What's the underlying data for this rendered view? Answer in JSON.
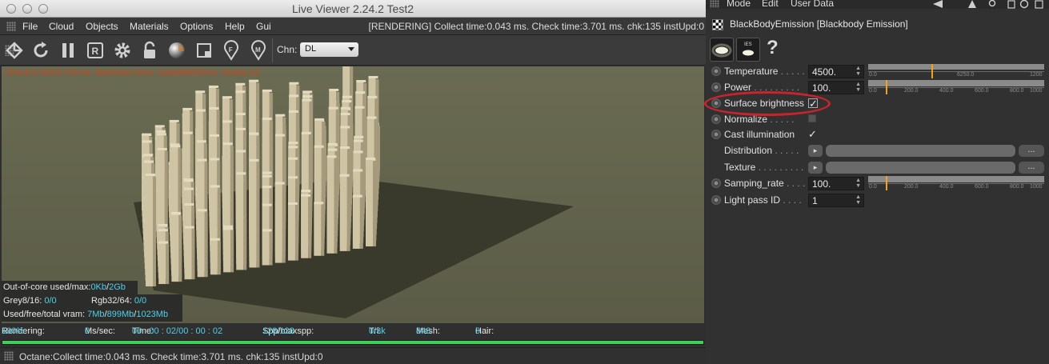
{
  "window": {
    "title": "Live Viewer 2.24.2 Test2"
  },
  "menu": {
    "items": [
      "File",
      "Cloud",
      "Objects",
      "Materials",
      "Options",
      "Help",
      "Gui"
    ],
    "render_status": "[RENDERING] Collect time:0.043 ms.  Check time:3.701 ms.  chk:135  instUpd:0"
  },
  "toolbar": {
    "icons": [
      "render-target-icon",
      "refresh-icon",
      "pause-icon",
      "region-render-icon",
      "settings-gear-icon",
      "lock-icon",
      "material-sphere-icon",
      "focus-frame-icon",
      "pin-f-icon",
      "pin-m-icon"
    ],
    "channel_label": "Chn:",
    "channel_value": "DL"
  },
  "viewport": {
    "overlay": "Check:0.462/3.701ms. MeshGen:0ms. Update[M]:0ms. Nodes:22"
  },
  "info": {
    "ooc_label": "Out-of-core used/max:",
    "ooc_used": "0Kb",
    "ooc_max": "2Gb",
    "grey_label": "Grey8/16:",
    "grey_value": "0/0",
    "rgb_label": "Rgb32/64:",
    "rgb_value": "0/0",
    "vram_label": "Used/free/total vram:",
    "vram_used": "7Mb",
    "vram_free": "899Mb",
    "vram_total": "1023Mb"
  },
  "status": {
    "rendering_label": "Rendering:",
    "rendering_value": "100%",
    "mssec_label": "Ms/sec:",
    "mssec_value": "0",
    "time_label": "Time:",
    "time_value": "00 : 00 : 02/00 : 00 : 02",
    "spp_label": "Spp/maxspp:",
    "spp_value": "128/128",
    "tri_label": "Tri:",
    "tri_value": "0/3k",
    "mesh_label": "Mesh:",
    "mesh_value": "843",
    "hair_label": "Hair:",
    "hair_value": "0",
    "progress": 1.0
  },
  "bottom": {
    "text": "Octane:Collect time:0.043 ms.  Check time:3.701 ms.  chk:135  instUpd:0"
  },
  "panel": {
    "menu": [
      "Mode",
      "Edit",
      "User Data"
    ],
    "title": "BlackBodyEmission [Blackbody Emission]",
    "tab2_label": "IES",
    "help": "?",
    "params": {
      "temperature": {
        "label": "Temperature",
        "dots": ". . . . .",
        "value": "4500.",
        "ticks": [
          "0.0",
          "6250.0",
          "1200"
        ],
        "marker": 0.36
      },
      "power": {
        "label": "Power",
        "dots": ". . . . . . . . .",
        "value": "100.",
        "ticks": [
          "0.0",
          "200.0",
          "400.0",
          "600.0",
          "800.0",
          "1000"
        ],
        "marker": 0.1
      },
      "surface": {
        "label": "Surface brightness",
        "checked": true
      },
      "normalize": {
        "label": "Normalize",
        "dots": ". . . . .",
        "checked": false
      },
      "cast": {
        "label": "Cast illumination",
        "checked": true
      },
      "distribution": {
        "label": "Distribution",
        "dots": ". . . . .",
        "arrow": "▸",
        "ellipsis": "..."
      },
      "texture": {
        "label": "Texture",
        "dots": ". . . . . . . . .",
        "arrow": "▸",
        "ellipsis": "..."
      },
      "sampling": {
        "label": "Samping_rate",
        "dots": ". . . .",
        "value": "100.",
        "ticks": [
          "0.0",
          "200.0",
          "400.0",
          "600.0",
          "800.0",
          "1000"
        ],
        "marker": 0.1
      },
      "lightpass": {
        "label": "Light pass ID",
        "dots": ". . . .",
        "value": "1"
      }
    }
  }
}
